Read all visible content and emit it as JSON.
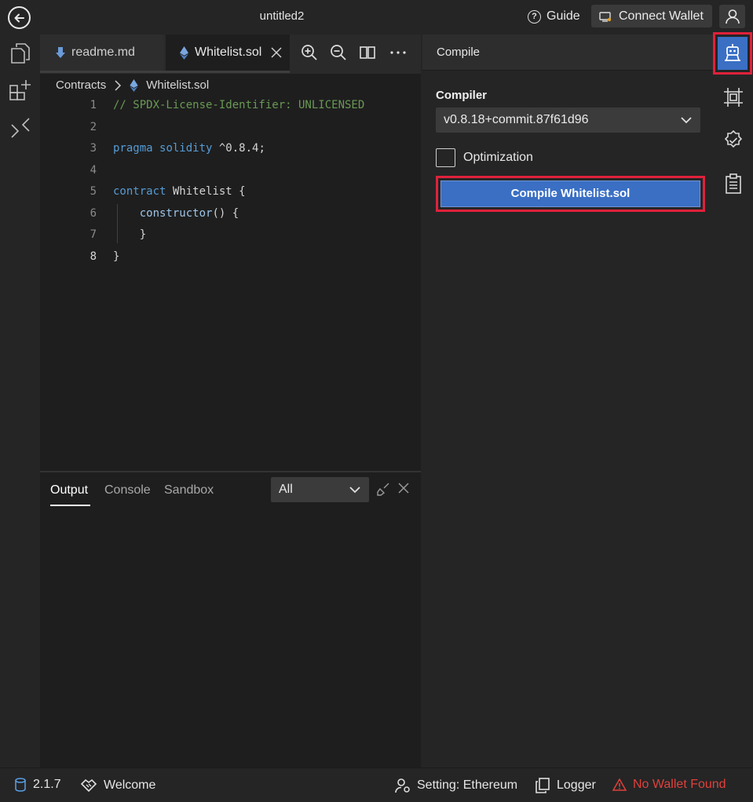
{
  "window": {
    "title": "untitled2",
    "guide_label": "Guide",
    "connect_wallet_label": "Connect Wallet"
  },
  "tabs": [
    {
      "label": "readme.md"
    },
    {
      "label": "Whitelist.sol"
    }
  ],
  "breadcrumb": {
    "root": "Contracts",
    "file": "Whitelist.sol"
  },
  "code_lines": [
    {
      "n": "1",
      "text": "// SPDX-License-Identifier: UNLICENSED"
    },
    {
      "n": "2",
      "text": ""
    },
    {
      "n": "3",
      "text": "pragma solidity ^0.8.4;"
    },
    {
      "n": "4",
      "text": ""
    },
    {
      "n": "5",
      "text": "contract Whitelist {"
    },
    {
      "n": "6",
      "text": "    constructor() {"
    },
    {
      "n": "7",
      "text": "    }"
    },
    {
      "n": "8",
      "text": "}"
    }
  ],
  "panel": {
    "tabs": [
      "Output",
      "Console",
      "Sandbox"
    ],
    "filter_value": "All"
  },
  "compile": {
    "header": "Compile",
    "compiler_label": "Compiler",
    "compiler_version": "v0.8.18+commit.87f61d96",
    "optimization_label": "Optimization",
    "optimization_checked": false,
    "button_label": "Compile Whitelist.sol"
  },
  "statusbar": {
    "version": "2.1.7",
    "welcome": "Welcome",
    "setting": "Setting: Ethereum",
    "logger": "Logger",
    "wallet_status": "No Wallet Found"
  },
  "colors": {
    "accent": "#3a6fc4",
    "highlight": "#e0213a",
    "error": "#e0413a",
    "comment": "#6a9955",
    "keyword": "#569cd6"
  }
}
